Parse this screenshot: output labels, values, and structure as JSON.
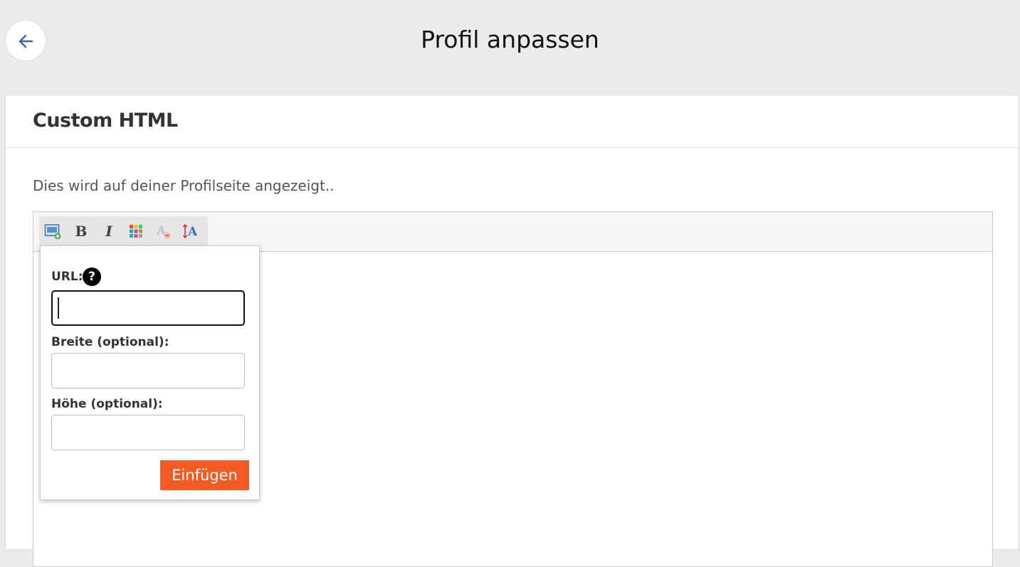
{
  "header": {
    "title": "Profil anpassen",
    "back_icon": "arrow-left-icon"
  },
  "card": {
    "title": "Custom HTML",
    "description": "Dies wird auf deiner Profilseite angezeigt.."
  },
  "toolbar": {
    "items": [
      {
        "name": "insert-image",
        "icon": "image-add-icon"
      },
      {
        "name": "bold",
        "label": "B",
        "icon": "bold-icon"
      },
      {
        "name": "italic",
        "label": "I",
        "icon": "italic-icon"
      },
      {
        "name": "color",
        "icon": "color-grid-icon"
      },
      {
        "name": "remove-format",
        "icon": "remove-format-icon"
      },
      {
        "name": "font-size",
        "icon": "font-size-icon"
      }
    ]
  },
  "popup": {
    "url_label": "URL:",
    "url_value": "",
    "help_symbol": "?",
    "width_label": "Breite (optional):",
    "width_value": "",
    "height_label": "Höhe (optional):",
    "height_value": "",
    "insert_label": "Einfügen"
  },
  "colors": {
    "accent": "#f45a21",
    "back_arrow": "#3a66b8",
    "background": "#ebebeb"
  }
}
